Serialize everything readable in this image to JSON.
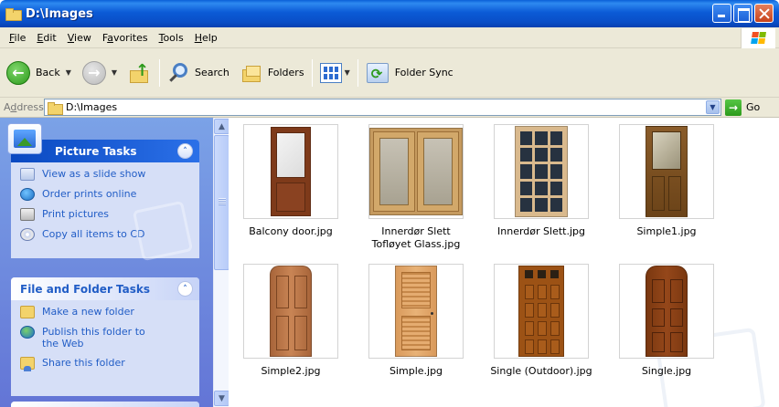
{
  "window": {
    "title": "D:\\Images"
  },
  "menu": [
    {
      "pre": "",
      "u": "F",
      "post": "ile"
    },
    {
      "pre": "",
      "u": "E",
      "post": "dit"
    },
    {
      "pre": "",
      "u": "V",
      "post": "iew"
    },
    {
      "pre": "F",
      "u": "a",
      "post": "vorites"
    },
    {
      "pre": "",
      "u": "T",
      "post": "ools"
    },
    {
      "pre": "",
      "u": "H",
      "post": "elp"
    }
  ],
  "toolbar": {
    "back_label": "Back",
    "search_label": "Search",
    "folders_label": "Folders",
    "sync_label": "Folder Sync"
  },
  "address": {
    "label_pre": "A",
    "label_u": "d",
    "label_post": "dress",
    "value": "D:\\Images",
    "go_label": "Go"
  },
  "picture_tasks": {
    "title": "Picture Tasks",
    "items": [
      {
        "label": "View as a slide show",
        "icon": "slideshow-icon"
      },
      {
        "label": "Order prints online",
        "icon": "order-prints-icon"
      },
      {
        "label": "Print pictures",
        "icon": "printer-icon"
      },
      {
        "label": "Copy all items to CD",
        "icon": "cd-icon"
      }
    ]
  },
  "file_tasks": {
    "title": "File and Folder Tasks",
    "items": [
      {
        "label": "Make a new folder",
        "icon": "new-folder-icon"
      },
      {
        "label": "Publish this folder to the Web",
        "icon": "web-publish-icon"
      },
      {
        "label": "Share this folder",
        "icon": "share-folder-icon"
      }
    ]
  },
  "files": [
    {
      "name": "Balcony door.jpg"
    },
    {
      "name": "Innerdør Slett Tofløyet Glass.jpg"
    },
    {
      "name": "Innerdør Slett.jpg"
    },
    {
      "name": "Simple1.jpg"
    },
    {
      "name": "Simple2.jpg"
    },
    {
      "name": "Simple.jpg"
    },
    {
      "name": "Single (Outdoor).jpg"
    },
    {
      "name": "Single.jpg"
    }
  ]
}
